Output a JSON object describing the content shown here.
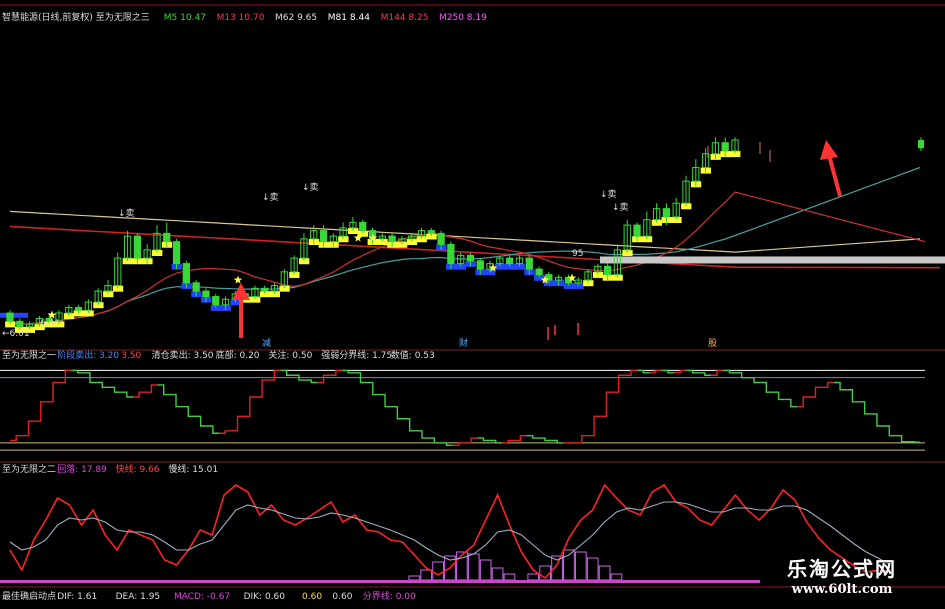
{
  "chart_data": [
    {
      "type": "candlestick",
      "panel": "main",
      "indicator_name": "智慧能源(日线,前复权) 至为无限之三",
      "legend": [
        {
          "label": "M5",
          "value": "10.47",
          "color": "#39d839"
        },
        {
          "label": "M13",
          "value": "10.70",
          "color": "#ff3355"
        },
        {
          "label": "M62",
          "value": "9.65",
          "color": "#dddddd"
        },
        {
          "label": "M81",
          "value": "8.44",
          "color": "#ffffff"
        },
        {
          "label": "M144",
          "value": "8.25",
          "color": "#ff3355"
        },
        {
          "label": "M250",
          "value": "8.19",
          "color": "#ff55ff"
        }
      ],
      "annotations": {
        "price_low": "6.01",
        "price_low_left": "←6.01",
        "mid_mark": "95",
        "sell_marks": [
          "↓卖",
          "↓卖",
          "↓卖",
          "↓卖",
          "↓卖"
        ],
        "bottom_tags": [
          "减",
          "财",
          "股"
        ]
      },
      "candles": [
        {
          "o": 6.6,
          "c": 6.3,
          "h": 6.7,
          "l": 6.2
        },
        {
          "o": 6.3,
          "c": 6.1,
          "h": 6.4,
          "l": 6.0
        },
        {
          "o": 6.1,
          "c": 6.2,
          "h": 6.3,
          "l": 6.01
        },
        {
          "o": 6.2,
          "c": 6.4,
          "h": 6.5,
          "l": 6.1
        },
        {
          "o": 6.4,
          "c": 6.3,
          "h": 6.6,
          "l": 6.2
        },
        {
          "o": 6.3,
          "c": 6.6,
          "h": 6.7,
          "l": 6.2
        },
        {
          "o": 6.6,
          "c": 6.8,
          "h": 6.9,
          "l": 6.5
        },
        {
          "o": 6.8,
          "c": 6.7,
          "h": 6.9,
          "l": 6.6
        },
        {
          "o": 6.7,
          "c": 7.0,
          "h": 7.1,
          "l": 6.6
        },
        {
          "o": 7.0,
          "c": 7.4,
          "h": 7.5,
          "l": 6.9
        },
        {
          "o": 7.4,
          "c": 7.6,
          "h": 7.8,
          "l": 7.3
        },
        {
          "o": 7.6,
          "c": 8.6,
          "h": 8.8,
          "l": 7.5
        },
        {
          "o": 8.6,
          "c": 9.4,
          "h": 9.6,
          "l": 8.5
        },
        {
          "o": 9.4,
          "c": 8.6,
          "h": 9.5,
          "l": 8.4
        },
        {
          "o": 8.6,
          "c": 8.9,
          "h": 9.1,
          "l": 8.4
        },
        {
          "o": 8.9,
          "c": 9.5,
          "h": 9.8,
          "l": 8.8
        },
        {
          "o": 9.5,
          "c": 9.2,
          "h": 9.9,
          "l": 9.0
        },
        {
          "o": 9.2,
          "c": 8.4,
          "h": 9.3,
          "l": 8.2
        },
        {
          "o": 8.4,
          "c": 7.7,
          "h": 8.5,
          "l": 7.5
        },
        {
          "o": 7.7,
          "c": 7.4,
          "h": 7.8,
          "l": 7.2
        },
        {
          "o": 7.4,
          "c": 7.2,
          "h": 7.5,
          "l": 7.0
        },
        {
          "o": 7.2,
          "c": 6.9,
          "h": 7.3,
          "l": 6.8
        },
        {
          "o": 6.9,
          "c": 7.1,
          "h": 7.2,
          "l": 6.7
        },
        {
          "o": 7.1,
          "c": 7.3,
          "h": 7.4,
          "l": 7.0
        },
        {
          "o": 7.3,
          "c": 7.2,
          "h": 7.4,
          "l": 7.1
        },
        {
          "o": 7.2,
          "c": 7.5,
          "h": 7.6,
          "l": 7.1
        },
        {
          "o": 7.5,
          "c": 7.4,
          "h": 7.6,
          "l": 7.3
        },
        {
          "o": 7.4,
          "c": 7.6,
          "h": 7.7,
          "l": 7.3
        },
        {
          "o": 7.6,
          "c": 8.1,
          "h": 8.2,
          "l": 7.5
        },
        {
          "o": 8.1,
          "c": 8.6,
          "h": 8.7,
          "l": 8.0
        },
        {
          "o": 8.6,
          "c": 9.3,
          "h": 9.5,
          "l": 8.5
        },
        {
          "o": 9.3,
          "c": 9.6,
          "h": 9.8,
          "l": 9.1
        },
        {
          "o": 9.6,
          "c": 9.2,
          "h": 9.8,
          "l": 9.0
        },
        {
          "o": 9.2,
          "c": 9.4,
          "h": 9.5,
          "l": 9.0
        },
        {
          "o": 9.4,
          "c": 9.7,
          "h": 9.9,
          "l": 9.3
        },
        {
          "o": 9.7,
          "c": 9.9,
          "h": 10.1,
          "l": 9.6
        },
        {
          "o": 9.9,
          "c": 9.6,
          "h": 10.0,
          "l": 9.5
        },
        {
          "o": 9.6,
          "c": 9.3,
          "h": 9.7,
          "l": 9.1
        },
        {
          "o": 9.3,
          "c": 9.4,
          "h": 9.5,
          "l": 9.2
        },
        {
          "o": 9.4,
          "c": 9.2,
          "h": 9.5,
          "l": 9.0
        },
        {
          "o": 9.2,
          "c": 9.3,
          "h": 9.4,
          "l": 9.1
        },
        {
          "o": 9.3,
          "c": 9.4,
          "h": 9.5,
          "l": 9.2
        },
        {
          "o": 9.4,
          "c": 9.6,
          "h": 9.7,
          "l": 9.3
        },
        {
          "o": 9.6,
          "c": 9.5,
          "h": 9.7,
          "l": 9.4
        },
        {
          "o": 9.5,
          "c": 9.1,
          "h": 9.6,
          "l": 8.9
        },
        {
          "o": 9.1,
          "c": 8.4,
          "h": 9.2,
          "l": 8.2
        },
        {
          "o": 8.4,
          "c": 8.7,
          "h": 8.8,
          "l": 8.3
        },
        {
          "o": 8.7,
          "c": 8.5,
          "h": 8.8,
          "l": 8.3
        },
        {
          "o": 8.5,
          "c": 8.2,
          "h": 8.6,
          "l": 8.0
        },
        {
          "o": 8.2,
          "c": 8.4,
          "h": 8.5,
          "l": 8.1
        },
        {
          "o": 8.4,
          "c": 8.6,
          "h": 8.7,
          "l": 8.3
        },
        {
          "o": 8.6,
          "c": 8.4,
          "h": 8.7,
          "l": 8.3
        },
        {
          "o": 8.4,
          "c": 8.6,
          "h": 8.7,
          "l": 8.3
        },
        {
          "o": 8.6,
          "c": 8.2,
          "h": 8.7,
          "l": 8.0
        },
        {
          "o": 8.2,
          "c": 8.0,
          "h": 8.3,
          "l": 7.9
        },
        {
          "o": 8.0,
          "c": 7.8,
          "h": 8.1,
          "l": 7.7
        },
        {
          "o": 7.8,
          "c": 7.9,
          "h": 8.0,
          "l": 7.6
        },
        {
          "o": 7.9,
          "c": 7.7,
          "h": 8.0,
          "l": 7.6
        },
        {
          "o": 7.7,
          "c": 7.8,
          "h": 7.9,
          "l": 7.6
        },
        {
          "o": 7.8,
          "c": 8.1,
          "h": 8.2,
          "l": 7.7
        },
        {
          "o": 8.1,
          "c": 8.3,
          "h": 8.4,
          "l": 8.0
        },
        {
          "o": 8.3,
          "c": 8.0,
          "h": 8.4,
          "l": 7.8
        },
        {
          "o": 8.0,
          "c": 8.9,
          "h": 9.1,
          "l": 7.9
        },
        {
          "o": 8.9,
          "c": 9.8,
          "h": 10.0,
          "l": 8.8
        },
        {
          "o": 9.8,
          "c": 9.4,
          "h": 9.9,
          "l": 9.2
        },
        {
          "o": 9.4,
          "c": 10.0,
          "h": 10.3,
          "l": 9.3
        },
        {
          "o": 10.0,
          "c": 10.4,
          "h": 10.6,
          "l": 9.9
        },
        {
          "o": 10.4,
          "c": 10.1,
          "h": 10.6,
          "l": 9.8
        },
        {
          "o": 10.1,
          "c": 10.6,
          "h": 10.8,
          "l": 10.0
        },
        {
          "o": 10.6,
          "c": 11.4,
          "h": 11.6,
          "l": 10.5
        },
        {
          "o": 11.4,
          "c": 11.9,
          "h": 12.2,
          "l": 11.2
        },
        {
          "o": 11.9,
          "c": 12.4,
          "h": 12.6,
          "l": 11.7
        },
        {
          "o": 12.4,
          "c": 12.8,
          "h": 13.0,
          "l": 12.2
        },
        {
          "o": 12.8,
          "c": 12.5,
          "h": 13.0,
          "l": 12.3
        },
        {
          "o": 12.5,
          "c": 12.9,
          "h": 13.0,
          "l": 12.4
        }
      ],
      "last_bar": {
        "o": 12.6,
        "c": 12.9,
        "h": 13.0,
        "l": 12.5
      },
      "colors": {
        "up": "#39d839",
        "down": "#39d839",
        "signal": "#ffff33",
        "falling": "#2244ff",
        "ma_red": "#cc2222",
        "ma_cream": "#d8c890",
        "ma_teal": "#44a0a0"
      }
    },
    {
      "type": "line",
      "panel": "indicator1",
      "indicator_name": "至为无限之一",
      "legend": [
        {
          "label": "阶段卖出:",
          "value": "3.20",
          "color": "#4488ff"
        },
        {
          "label": "",
          "value": "3.50",
          "color": "#ff4444"
        },
        {
          "label": "清仓卖出:",
          "value": "3.50",
          "color": "#dddddd"
        },
        {
          "label": "底部:",
          "value": "0.20",
          "color": "#dddddd"
        },
        {
          "label": "关注:",
          "value": "0.50",
          "color": "#dddddd"
        },
        {
          "label": "强弱分界线:",
          "value": "1.75",
          "color": "#dddddd"
        },
        {
          "label": "数值:",
          "value": "0.53",
          "color": "#dddddd"
        }
      ],
      "y_range": [
        0,
        3.6
      ],
      "levels": [
        3.5,
        3.2,
        0.5,
        0.2
      ],
      "values": [
        0.6,
        0.8,
        1.4,
        2.2,
        3.0,
        3.5,
        3.4,
        3.0,
        2.8,
        2.6,
        2.4,
        2.6,
        2.9,
        2.5,
        2.0,
        1.6,
        1.2,
        0.9,
        1.0,
        1.6,
        2.4,
        3.1,
        3.5,
        3.3,
        3.1,
        3.0,
        3.3,
        3.5,
        3.4,
        3.0,
        2.5,
        2.0,
        1.5,
        1.0,
        0.7,
        0.5,
        0.4,
        0.5,
        0.7,
        0.6,
        0.5,
        0.6,
        0.8,
        0.7,
        0.6,
        0.5,
        0.5,
        0.8,
        1.6,
        2.6,
        3.3,
        3.5,
        3.4,
        3.5,
        3.4,
        3.5,
        3.4,
        3.3,
        3.5,
        3.4,
        3.2,
        3.0,
        2.6,
        2.3,
        2.0,
        2.4,
        2.8,
        3.0,
        2.7,
        2.2,
        1.7,
        1.2,
        0.8,
        0.55,
        0.53
      ],
      "colors": {
        "up": "#dd2222",
        "down": "#44cc44",
        "level": "#c0c0e0"
      }
    },
    {
      "type": "line",
      "panel": "indicator2",
      "indicator_name": "至为无限之二",
      "legend": [
        {
          "label": "回落:",
          "value": "17.89",
          "color": "#dd44dd"
        },
        {
          "label": "快线:",
          "value": "9.66",
          "color": "#ff4444"
        },
        {
          "label": "慢线:",
          "value": "15.01",
          "color": "#dddddd"
        }
      ],
      "y_range": [
        0,
        100
      ],
      "series": [
        {
          "name": "快线",
          "color": "#ff2222",
          "values": [
            30,
            10,
            40,
            60,
            82,
            75,
            55,
            70,
            45,
            30,
            50,
            45,
            40,
            20,
            15,
            30,
            50,
            45,
            85,
            95,
            88,
            65,
            75,
            60,
            55,
            62,
            70,
            78,
            58,
            65,
            50,
            48,
            40,
            38,
            25,
            12,
            5,
            12,
            25,
            35,
            60,
            85,
            55,
            28,
            10,
            2,
            15,
            42,
            60,
            70,
            95,
            82,
            70,
            65,
            88,
            95,
            78,
            72,
            60,
            55,
            70,
            85,
            70,
            60,
            72,
            90,
            80,
            58,
            42,
            30,
            22,
            14,
            8,
            9.66,
            9
          ]
        },
        {
          "name": "慢线",
          "color": "#9ab0c0",
          "values": [
            38,
            30,
            33,
            40,
            55,
            62,
            60,
            62,
            58,
            50,
            48,
            48,
            45,
            38,
            30,
            30,
            36,
            40,
            55,
            70,
            75,
            72,
            70,
            66,
            62,
            61,
            63,
            67,
            65,
            62,
            58,
            54,
            50,
            45,
            40,
            32,
            25,
            20,
            22,
            26,
            35,
            48,
            50,
            45,
            35,
            25,
            20,
            25,
            35,
            45,
            58,
            68,
            72,
            70,
            74,
            78,
            78,
            76,
            72,
            68,
            68,
            72,
            72,
            70,
            70,
            74,
            74,
            70,
            62,
            54,
            45,
            36,
            28,
            22,
            15.01
          ]
        }
      ],
      "histogram": {
        "color": "#cc66ee",
        "segments": [
          {
            "start": 34,
            "values": [
              4,
              10,
              18,
              24,
              28,
              26,
              20,
              12,
              6
            ]
          },
          {
            "start": 44,
            "values": [
              6,
              14,
              24,
              30,
              28,
              22,
              14,
              6
            ]
          }
        ]
      }
    },
    {
      "type": "bar",
      "panel": "indicator3",
      "indicator_name": "最佳确启动点",
      "legend": [
        {
          "label": "DIF:",
          "value": "1.61",
          "color": "#dddddd"
        },
        {
          "label": "DEA:",
          "value": "1.95",
          "color": "#dddddd"
        },
        {
          "label": "MACD:",
          "value": "-0.67",
          "color": "#dd44dd"
        },
        {
          "label": "DIK:",
          "value": "0.60",
          "color": "#dddddd"
        },
        {
          "label": "",
          "value": "0.60",
          "color": "#ffdd33"
        },
        {
          "label": "",
          "value": "0.60",
          "color": "#dddddd"
        },
        {
          "label": "分界线:",
          "value": "0.00",
          "color": "#dd44dd"
        }
      ]
    }
  ],
  "watermark": {
    "title": "乐淘公式网",
    "url": "www.60lt.com"
  }
}
